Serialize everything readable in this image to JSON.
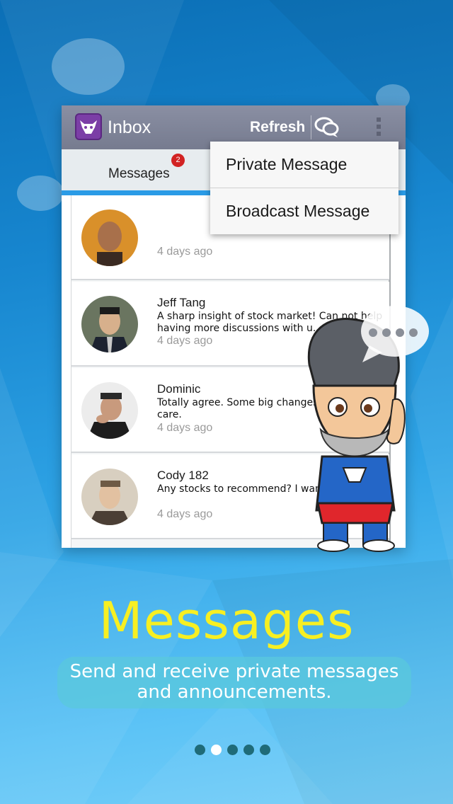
{
  "app_bar": {
    "title": "Inbox",
    "refresh_label": "Refresh",
    "chat_icon": "chat-bubbles-icon",
    "more_icon": "overflow-menu-icon"
  },
  "tabs": [
    {
      "label": "Messages",
      "badge": "2"
    }
  ],
  "popup_menu": {
    "items": [
      "Private Message",
      "Broadcast Message"
    ]
  },
  "messages": [
    {
      "name": "",
      "text": "",
      "time": "4 days ago"
    },
    {
      "name": "Jeff Tang",
      "text": "A sharp insight of stock market! Can not help having more discussions with u.",
      "time": "4 days ago"
    },
    {
      "name": "Dominic",
      "text": "Totally agree. Some big changes soon. Take care.",
      "time": "4 days ago"
    },
    {
      "name": "Cody 182",
      "text": "Any stocks to recommend? I wanna",
      "time": "4 days ago"
    }
  ],
  "feature": {
    "title": "Messages",
    "subtitle_line1": "Send and receive private messages",
    "subtitle_line2": "and announcements."
  },
  "pager": {
    "count": 5,
    "active_index": 1
  },
  "colors": {
    "headline": "#f7ef22",
    "tab_indicator": "#2a9be6",
    "badge": "#d22323",
    "app_bar": "#7e8397"
  }
}
